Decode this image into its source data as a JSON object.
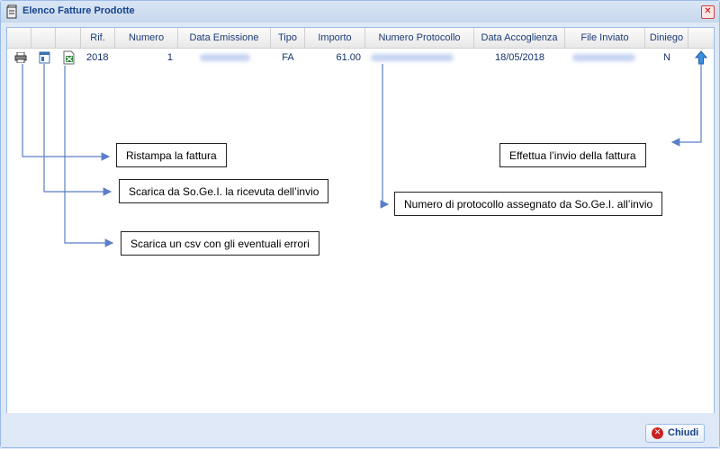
{
  "window": {
    "title": "Elenco Fatture Prodotte",
    "close_glyph": "✕"
  },
  "columns": [
    "Rif.",
    "Numero",
    "Data Emissione",
    "Tipo",
    "Importo",
    "Numero Protocollo",
    "Data Accoglienza",
    "File Inviato",
    "Diniego"
  ],
  "row": {
    "rif": "2018",
    "numero": "1",
    "tipo": "FA",
    "importo": "61.00",
    "data_accoglienza": "18/05/2018",
    "diniego": "N"
  },
  "icons": {
    "reprint": "printer-icon",
    "receipt": "document-icon",
    "csv": "excel-icon",
    "send": "up-arrow-icon"
  },
  "callouts": {
    "reprint": "Ristampa la fattura",
    "receipt": "Scarica da So.Ge.I. la ricevuta dell’invio",
    "csv": "Scarica un csv con gli eventuali errori",
    "protocol": "Numero di protocollo assegnato da So.Ge.I. all’invio",
    "send": "Effettua l’invio della fattura"
  },
  "footer": {
    "close_label": "Chiudi"
  },
  "colors": {
    "header_text": "#15428b",
    "border": "#99bbe8",
    "arrow": "#5b7ec6"
  }
}
